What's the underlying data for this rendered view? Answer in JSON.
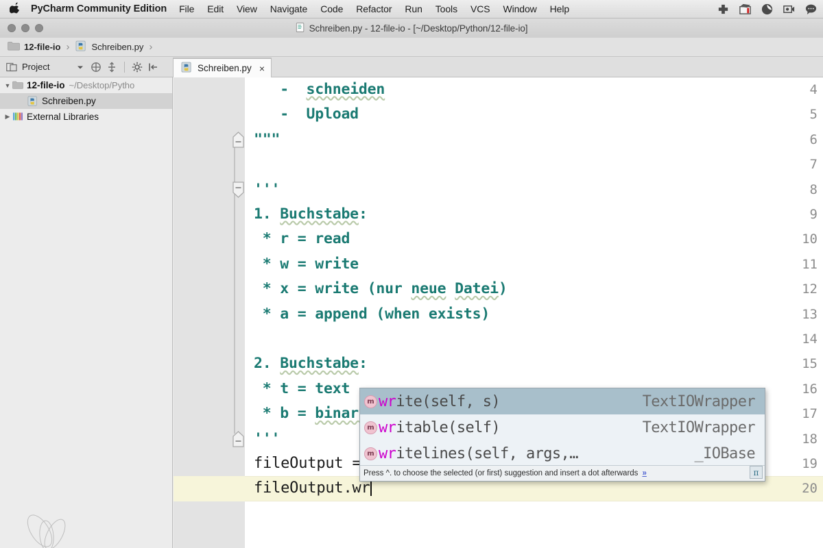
{
  "menubar": {
    "apple_icon": "apple-logo-icon",
    "app_name": "PyCharm Community Edition",
    "items": [
      "File",
      "Edit",
      "View",
      "Navigate",
      "Code",
      "Refactor",
      "Run",
      "Tools",
      "VCS",
      "Window",
      "Help"
    ],
    "status_icons": [
      "plus-cross-icon",
      "clapperboard-icon",
      "droplet-icon",
      "video-camera-icon",
      "speech-bubble-icon"
    ]
  },
  "titlebar": {
    "title": "Schreiben.py - 12-file-io - [~/Desktop/Python/12-file-io]",
    "file_icon": "python-file-icon"
  },
  "breadcrumb": {
    "folder": "12-file-io",
    "file": "Schreiben.py",
    "separator": "›"
  },
  "toolbar": {
    "project_label": "Project",
    "icons": [
      "project-view-icon",
      "chevron-down-icon",
      "collapse-all-icon",
      "expand-all-icon",
      "settings-gear-icon",
      "hide-panel-icon"
    ]
  },
  "tabs": [
    {
      "label": "Schreiben.py",
      "close": "×",
      "active": true
    }
  ],
  "project_tree": [
    {
      "arrow": "▼",
      "label": "12-file-io",
      "path": "~/Desktop/Pytho",
      "icon": "folder-icon",
      "bold": true,
      "indent": 0,
      "selected": false
    },
    {
      "arrow": "",
      "label": "Schreiben.py",
      "path": "",
      "icon": "python-file-icon",
      "bold": false,
      "indent": 1,
      "selected": true
    },
    {
      "arrow": "▶",
      "label": "External Libraries",
      "path": "",
      "icon": "libraries-icon",
      "bold": false,
      "indent": 0,
      "selected": false
    }
  ],
  "editor": {
    "current_line": 20,
    "lines": [
      {
        "n": "4",
        "text": "   -  schneiden",
        "style": "doc",
        "squiggle": "schneiden",
        "fold": "none"
      },
      {
        "n": "5",
        "text": "   -  Upload",
        "style": "doc",
        "fold": "none"
      },
      {
        "n": "6",
        "text": "\"\"\"",
        "style": "doc",
        "fold": "end"
      },
      {
        "n": "7",
        "text": "",
        "style": "doc",
        "fold": "none"
      },
      {
        "n": "8",
        "text": "'''",
        "style": "doc",
        "fold": "start"
      },
      {
        "n": "9",
        "text": "1. Buchstabe:",
        "style": "doc",
        "squiggle": "Buchstabe",
        "fold": "none"
      },
      {
        "n": "10",
        "text": " * r = read",
        "style": "doc",
        "fold": "none"
      },
      {
        "n": "11",
        "text": " * w = write",
        "style": "doc",
        "fold": "none"
      },
      {
        "n": "12",
        "text": " * x = write (nur neue Datei)",
        "style": "doc",
        "fold": "none"
      },
      {
        "n": "13",
        "text": " * a = append (when exists)",
        "style": "doc",
        "fold": "none"
      },
      {
        "n": "14",
        "text": "",
        "style": "doc",
        "fold": "none"
      },
      {
        "n": "15",
        "text": "2. Buchstabe:",
        "style": "doc",
        "squiggle": "Buchstabe",
        "fold": "none"
      },
      {
        "n": "16",
        "text": " * t = text",
        "style": "doc",
        "fold": "none"
      },
      {
        "n": "17",
        "text": " * b = binary",
        "style": "doc",
        "fold": "none"
      },
      {
        "n": "18",
        "text": "'''",
        "style": "doc",
        "fold": "end"
      },
      {
        "n": "19",
        "text": "fileOutput = open(\"beispiel.txt\", \"w\")",
        "style": "plain",
        "fold": "none"
      },
      {
        "n": "20",
        "text": "fileOutput.wr",
        "style": "plain",
        "fold": "none",
        "caret": true
      }
    ]
  },
  "autocomplete": {
    "items": [
      {
        "badge": "m",
        "prefix": "wr",
        "rest": "ite(self, s)",
        "type": "TextIOWrapper",
        "selected": true
      },
      {
        "badge": "m",
        "prefix": "wr",
        "rest": "itable(self)",
        "type": "TextIOWrapper",
        "selected": false
      },
      {
        "badge": "m",
        "prefix": "wr",
        "rest": "itelines(self, args,…",
        "type": "_IOBase",
        "selected": false
      }
    ],
    "hint": "Press ^. to choose the selected (or first) suggestion and insert a dot afterwards",
    "hint_link": "»",
    "pi_label": "π"
  },
  "colors": {
    "docstring": "#1a7a72",
    "code_text": "#1a1a1a",
    "current_line": "#f7f5da",
    "selection": "#a8bfcb",
    "prefix_match": "#cc00cc",
    "gutter": "#e3e3e3"
  }
}
